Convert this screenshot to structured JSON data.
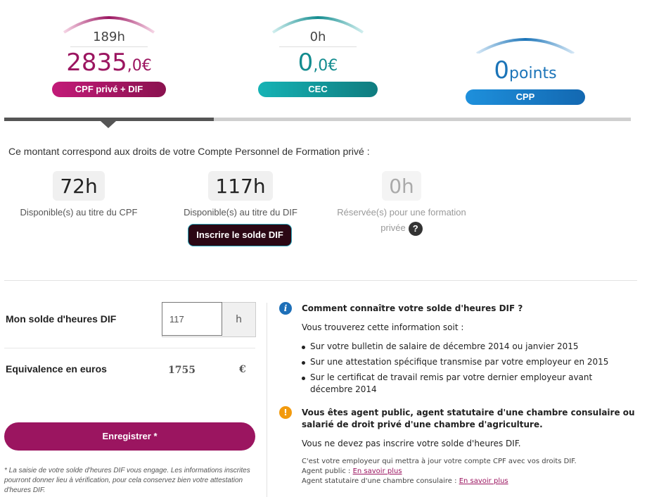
{
  "counters": {
    "cpf": {
      "hours": "189h",
      "amount_int": "2835",
      "amount_dec": ",0€",
      "label": "CPF privé + DIF",
      "color": "#9b1560"
    },
    "cec": {
      "hours": "0h",
      "amount_int": "0",
      "amount_dec": ",0€",
      "label": "CEC",
      "color": "#138c8f"
    },
    "cpp": {
      "amount_int": "0",
      "unit": "points",
      "label": "CPP",
      "color": "#1b74b8"
    }
  },
  "intro": "Ce montant correspond aux droits de votre Compte Personnel de Formation privé :",
  "rights": [
    {
      "value": "72h",
      "label": "Disponible(s) au titre du CPF"
    },
    {
      "value": "117h",
      "label": "Disponible(s) au titre du DIF"
    },
    {
      "value": "0h",
      "label_line1": "Réservée(s) pour une formation",
      "label_line2": "privée"
    }
  ],
  "help_icon": "?",
  "dif_button": "Inscrire le solde DIF",
  "form": {
    "dif_label": "Mon solde d'heures DIF",
    "dif_value": "117",
    "dif_unit": "h",
    "euro_label": "Equivalence en euros",
    "euro_value": "1755",
    "euro_symbol": "€",
    "save_label": "Enregistrer *",
    "note": "* La saisie de votre solde d'heures DIF vous engage. Les informations inscrites pourront donner lieu à vérification, pour cela conservez bien votre attestation d'heures DIF."
  },
  "info": {
    "icon": "i",
    "title": "Comment connaître votre solde d'heures DIF ?",
    "subtitle": "Vous trouverez cette information soit :",
    "bullets": [
      "Sur votre bulletin de salaire de décembre 2014 ou janvier 2015",
      "Sur une attestation spécifique transmise par votre employeur en 2015",
      "Sur le certificat de travail remis par votre dernier employeur avant décembre 2014"
    ]
  },
  "warn": {
    "icon": "!",
    "title_line1": "Vous êtes agent public, agent statutaire d'une chambre consulaire ou",
    "title_line2": "salarié de droit privé d'une chambre d'agriculture.",
    "text": "Vous ne devez pas inscrire votre solde d'heures DIF.",
    "small1": "C'est votre employeur qui mettra à jour votre compte CPF avec vos droits DIF.",
    "small2_prefix": "Agent public : ",
    "small2_link": "En savoir plus",
    "small3_prefix": "Agent statutaire d'une chambre consulaire : ",
    "small3_link": "En savoir plus"
  }
}
